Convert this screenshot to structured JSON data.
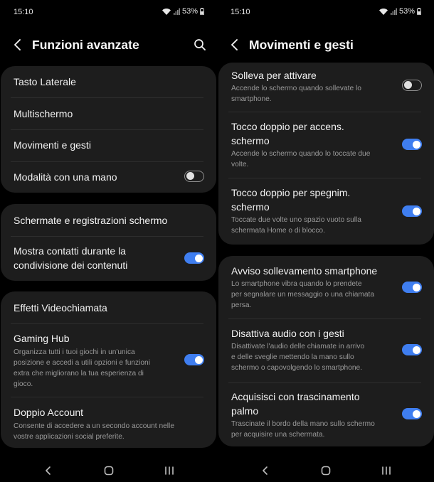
{
  "left": {
    "status": {
      "time": "15:10",
      "battery": "53%"
    },
    "header": {
      "title": "Funzioni avanzate"
    },
    "group1": {
      "item1": "Tasto Laterale",
      "item2": "Multischermo",
      "item3": "Movimenti e gesti",
      "item4": "Modalità con una mano",
      "item4_state": "off"
    },
    "group2": {
      "item1": "Schermate e registrazioni schermo",
      "item2_line1": "Mostra contatti durante la",
      "item2_line2": "condivisione dei contenuti",
      "item2_state": "on"
    },
    "group3": {
      "item1": "Effetti Videochiamata",
      "item2": "Gaming Hub",
      "item2_sub_l1": "Organizza tutti i tuoi giochi in un'unica",
      "item2_sub_l2": "posizione e accedi a utili opzioni e funzioni",
      "item2_sub_l3": "extra che migliorano la tua esperienza di",
      "item2_sub_l4": "gioco.",
      "item2_state": "on",
      "item3": "Doppio Account",
      "item3_sub_l1": "Consente di accedere a un secondo account nelle",
      "item3_sub_l2": "vostre applicazioni social preferite."
    }
  },
  "right": {
    "status": {
      "time": "15:10",
      "battery": "53%"
    },
    "header": {
      "title": "Movimenti e gesti"
    },
    "group1": {
      "item1": "Solleva per attivare",
      "item1_sub_l1": "Accende lo schermo quando sollevate lo",
      "item1_sub_l2": "smartphone.",
      "item1_state": "off",
      "item2_l1": "Tocco doppio per accens.",
      "item2_l2": "schermo",
      "item2_sub_l1": "Accende lo schermo quando lo toccate due",
      "item2_sub_l2": "volte.",
      "item2_state": "on",
      "item3_l1": "Tocco doppio per spegnim.",
      "item3_l2": "schermo",
      "item3_sub_l1": "Toccate due volte uno spazio vuoto sulla",
      "item3_sub_l2": "schermata Home o di blocco.",
      "item3_state": "on"
    },
    "group2": {
      "item1": "Avviso sollevamento smartphone",
      "item1_sub_l1": "Lo smartphone vibra quando lo prendete",
      "item1_sub_l2": "per segnalare un messaggio o una chiamata",
      "item1_sub_l3": "persa.",
      "item1_state": "on",
      "item2": "Disattiva audio con i gesti",
      "item2_sub_l1": "Disattivate l'audio delle chiamate in arrivo",
      "item2_sub_l2": "e delle sveglie mettendo la mano sullo",
      "item2_sub_l3": "schermo o capovolgendo lo smartphone.",
      "item2_state": "on",
      "item3_l1": "Acquisisci con trascinamento",
      "item3_l2": "palmo",
      "item3_sub_l1": "Trascinate il bordo della mano sullo schermo",
      "item3_sub_l2": "per acquisire una schermata.",
      "item3_state": "on"
    }
  },
  "icons": {
    "wifi": "wifi-icon",
    "signal": "signal-icon",
    "battery": "battery-icon",
    "back": "chevron-left-icon",
    "search": "search-icon",
    "nav_back": "nav-back-icon",
    "nav_home": "nav-home-icon",
    "nav_recents": "nav-recents-icon"
  },
  "colors": {
    "accent": "#3f7ef0",
    "card": "#1d1d1d",
    "background": "#000000",
    "subtext": "#9a9a9a"
  }
}
